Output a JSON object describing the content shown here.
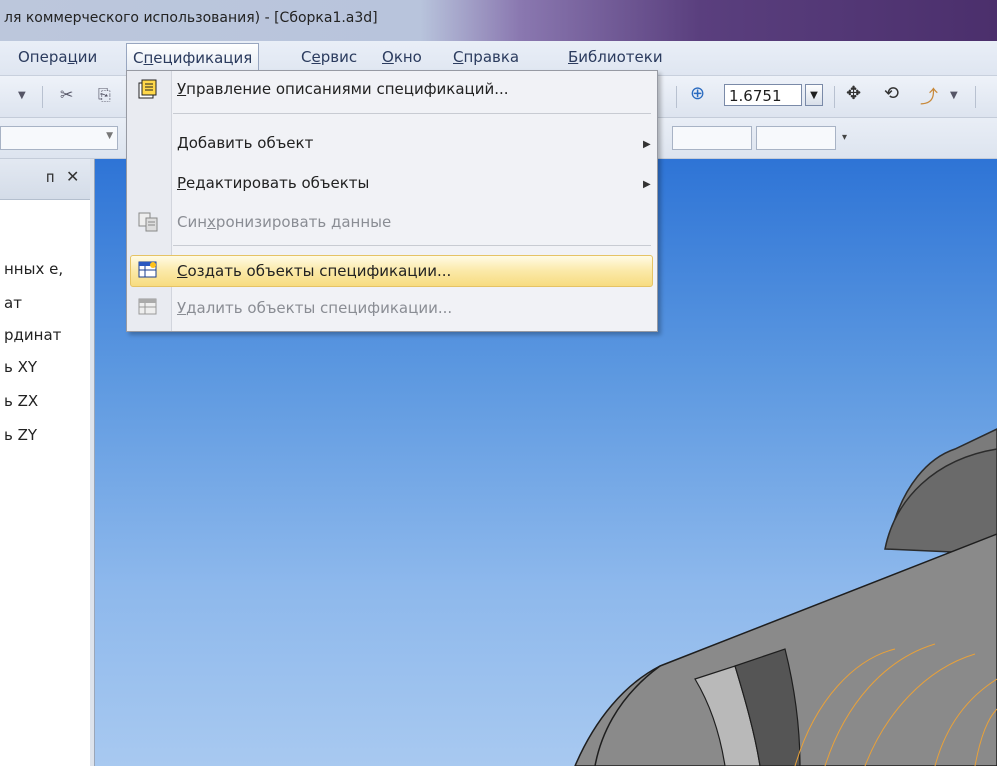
{
  "window": {
    "title": "ля коммерческого использования) - [Сборка1.a3d]"
  },
  "menubar": {
    "items": [
      {
        "label": "Операции",
        "ul": "ц"
      },
      {
        "label": "Спецификация",
        "ul": "п",
        "active": true
      },
      {
        "label": "Сервис",
        "ul": "е"
      },
      {
        "label": "Окно",
        "ul": "О"
      },
      {
        "label": "Справка",
        "ul": "С"
      },
      {
        "label": "Библиотеки",
        "ul": "Б"
      }
    ]
  },
  "toolbar": {
    "zoom_value": "1.6751"
  },
  "left_panel": {
    "pin_glyph": "ᴨ",
    "close_glyph": "✕",
    "tree": [
      "нных е,",
      "ат",
      "рдинат",
      "ь XY",
      "ь ZX",
      "ь ZY"
    ]
  },
  "dropdown": {
    "items": [
      {
        "label": "Управление описаниями спецификаций...",
        "icon": "spec-descriptions-icon",
        "disabled": false
      },
      {
        "label": "Добавить объект",
        "icon": "",
        "disabled": false,
        "submenu": true
      },
      {
        "label": "Редактировать объекты",
        "icon": "",
        "disabled": false,
        "submenu": true
      },
      {
        "label": "Синхронизировать данные",
        "icon": "sync-data-icon",
        "disabled": true
      },
      {
        "label": "Создать объекты спецификации...",
        "icon": "create-spec-objects-icon",
        "disabled": false,
        "highlighted": true
      },
      {
        "label": "Удалить объекты спецификации...",
        "icon": "delete-spec-objects-icon",
        "disabled": true
      }
    ]
  },
  "colors": {
    "highlight": "#fbe9a8",
    "viewport_top": "#2e74d6",
    "viewport_bottom": "#a8c9f0",
    "model_edge": "#e8a13a"
  }
}
